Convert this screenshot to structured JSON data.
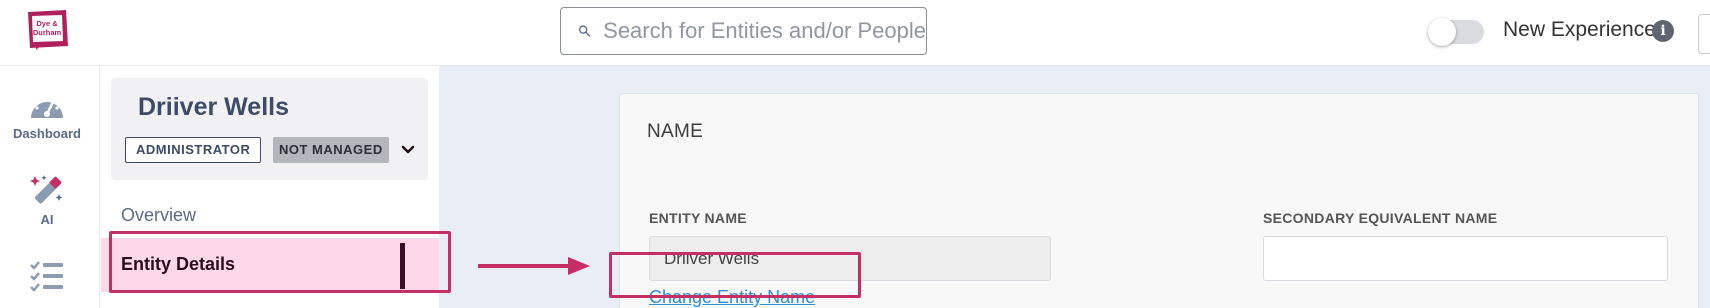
{
  "header": {
    "logo_line1": "Dye &",
    "logo_line2": "Durham",
    "search_placeholder": "Search for Entities and/or People",
    "new_experience_label": "New Experience",
    "new_experience_enabled": false,
    "info_glyph": "i"
  },
  "leftnav": {
    "items": [
      {
        "label": "Dashboard",
        "icon": "dashboard-gauge-icon"
      },
      {
        "label": "AI",
        "icon": "magic-wand-icon"
      },
      {
        "label": "",
        "icon": "checklist-icon"
      }
    ]
  },
  "entity": {
    "name": "Driiver Wells",
    "role_badge": "ADMINISTRATOR",
    "status_badge": "NOT MANAGED",
    "menu": [
      {
        "label": "Overview",
        "active": false
      },
      {
        "label": "Entity Details",
        "active": true
      }
    ]
  },
  "form": {
    "section_title": "NAME",
    "entity_name_label": "ENTITY NAME",
    "entity_name_value": "Driiver Wells",
    "secondary_name_label": "SECONDARY EQUIVALENT NAME",
    "secondary_name_value": "",
    "change_link": "Change Entity Name"
  },
  "colors": {
    "brand": "#b0205e",
    "highlight": "#c62f66",
    "active_bg": "#fdd9e8",
    "link": "#2f8fd4",
    "nav_text": "#5b6b86",
    "main_bg": "#e9edf5"
  }
}
